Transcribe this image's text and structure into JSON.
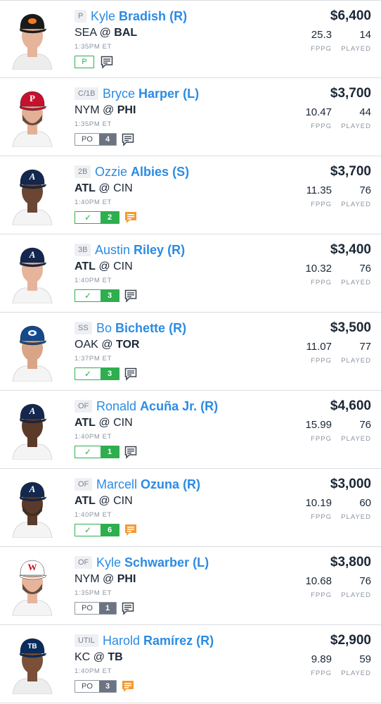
{
  "labels": {
    "fppg": "FPPG",
    "played": "PLAYED"
  },
  "colors": {
    "link_blue": "#2b8be3",
    "green": "#2eae4f",
    "orange": "#f39a33",
    "gray": "#6b7480"
  },
  "players": [
    {
      "position": "P",
      "first_name": "Kyle",
      "last_name": "Bradish",
      "hand": "(R)",
      "away": "SEA",
      "at": "@",
      "home": "BAL",
      "bold_team": "home",
      "time": "1:35PM ET",
      "salary": "$6,400",
      "fppg": "25.3",
      "played": "14",
      "badge": {
        "type": "p",
        "label": "P"
      },
      "note": "gray",
      "cap": "orioles",
      "skin": "#e6b49a",
      "cap_color": "#1a1a1a",
      "logo_color": "#f47a20",
      "beard": false
    },
    {
      "position": "C/1B",
      "first_name": "Bryce",
      "last_name": "Harper",
      "hand": "(L)",
      "away": "NYM",
      "at": "@",
      "home": "PHI",
      "bold_team": "home",
      "time": "1:35PM ET",
      "salary": "$3,700",
      "fppg": "10.47",
      "played": "44",
      "badge": {
        "type": "po",
        "label": "PO",
        "num": "4"
      },
      "note": "gray",
      "cap": "phillies",
      "skin": "#e3b096",
      "cap_color": "#c8102e",
      "logo_color": "#ffffff",
      "beard": true
    },
    {
      "position": "2B",
      "first_name": "Ozzie",
      "last_name": "Albies",
      "hand": "(S)",
      "away": "ATL",
      "at": "@",
      "home": "CIN",
      "bold_team": "away",
      "time": "1:40PM ET",
      "salary": "$3,700",
      "fppg": "11.35",
      "played": "76",
      "badge": {
        "type": "ok",
        "check": "✓",
        "num": "2"
      },
      "note": "orange",
      "cap": "braves",
      "skin": "#6b4632",
      "cap_color": "#13274f",
      "logo_color": "#ffffff",
      "beard": false
    },
    {
      "position": "3B",
      "first_name": "Austin",
      "last_name": "Riley",
      "hand": "(R)",
      "away": "ATL",
      "at": "@",
      "home": "CIN",
      "bold_team": "away",
      "time": "1:40PM ET",
      "salary": "$3,400",
      "fppg": "10.32",
      "played": "76",
      "badge": {
        "type": "ok",
        "check": "✓",
        "num": "3"
      },
      "note": "gray",
      "cap": "braves",
      "skin": "#e6b49a",
      "cap_color": "#13274f",
      "logo_color": "#ffffff",
      "beard": false
    },
    {
      "position": "SS",
      "first_name": "Bo",
      "last_name": "Bichette",
      "hand": "(R)",
      "away": "OAK",
      "at": "@",
      "home": "TOR",
      "bold_team": "home",
      "time": "1:37PM ET",
      "salary": "$3,500",
      "fppg": "11.07",
      "played": "77",
      "badge": {
        "type": "ok",
        "check": "✓",
        "num": "3"
      },
      "note": "gray",
      "cap": "bluejays",
      "skin": "#d9a587",
      "cap_color": "#134a8e",
      "logo_color": "#ffffff",
      "beard": false
    },
    {
      "position": "OF",
      "first_name": "Ronald",
      "last_name": "Acuña Jr.",
      "hand": "(R)",
      "away": "ATL",
      "at": "@",
      "home": "CIN",
      "bold_team": "away",
      "time": "1:40PM ET",
      "salary": "$4,600",
      "fppg": "15.99",
      "played": "76",
      "badge": {
        "type": "ok",
        "check": "✓",
        "num": "1"
      },
      "note": "gray",
      "cap": "braves",
      "skin": "#5c3a28",
      "cap_color": "#13274f",
      "logo_color": "#ffffff",
      "beard": false
    },
    {
      "position": "OF",
      "first_name": "Marcell",
      "last_name": "Ozuna",
      "hand": "(R)",
      "away": "ATL",
      "at": "@",
      "home": "CIN",
      "bold_team": "away",
      "time": "1:40PM ET",
      "salary": "$3,000",
      "fppg": "10.19",
      "played": "60",
      "badge": {
        "type": "ok",
        "check": "✓",
        "num": "6"
      },
      "note": "orange",
      "cap": "braves",
      "skin": "#5a3a2a",
      "cap_color": "#13274f",
      "logo_color": "#ffffff",
      "beard": true
    },
    {
      "position": "OF",
      "first_name": "Kyle",
      "last_name": "Schwarber",
      "hand": "(L)",
      "away": "NYM",
      "at": "@",
      "home": "PHI",
      "bold_team": "home",
      "time": "1:35PM ET",
      "salary": "$3,800",
      "fppg": "10.68",
      "played": "76",
      "badge": {
        "type": "po",
        "label": "PO",
        "num": "1"
      },
      "note": "gray",
      "cap": "nationals",
      "skin": "#e6b49a",
      "cap_color": "#ffffff",
      "logo_color": "#c8102e",
      "beard": true
    },
    {
      "position": "UTIL",
      "first_name": "Harold",
      "last_name": "Ramírez",
      "hand": "(R)",
      "away": "KC",
      "at": "@",
      "home": "TB",
      "bold_team": "home",
      "time": "1:40PM ET",
      "salary": "$2,900",
      "fppg": "9.89",
      "played": "59",
      "badge": {
        "type": "po",
        "label": "PO",
        "num": "3"
      },
      "note": "orange",
      "cap": "rays",
      "skin": "#7a5038",
      "cap_color": "#092c5c",
      "logo_color": "#ffffff",
      "beard": false
    }
  ]
}
